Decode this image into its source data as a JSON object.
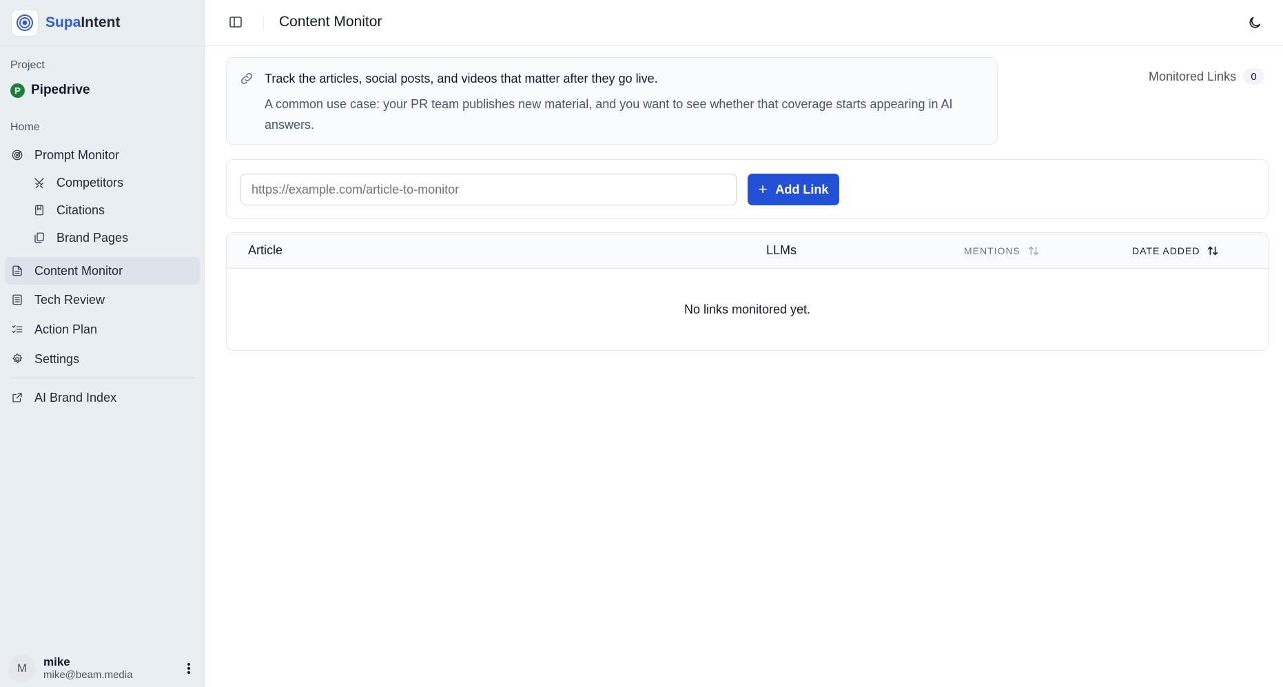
{
  "brand": {
    "name_part1": "Supa",
    "name_part2": "Intent"
  },
  "sidebar": {
    "project_label": "Project",
    "project": {
      "initial": "P",
      "name": "Pipedrive"
    },
    "home_label": "Home",
    "items": [
      {
        "label": "Prompt Monitor",
        "icon": "radar-icon"
      },
      {
        "label": "Competitors",
        "icon": "swords-icon"
      },
      {
        "label": "Citations",
        "icon": "bookmark-icon"
      },
      {
        "label": "Brand Pages",
        "icon": "pages-icon"
      },
      {
        "label": "Content Monitor",
        "icon": "document-icon",
        "active": true
      },
      {
        "label": "Tech Review",
        "icon": "list-document-icon"
      },
      {
        "label": "Action Plan",
        "icon": "checklist-icon"
      },
      {
        "label": "Settings",
        "icon": "gear-icon"
      },
      {
        "label": "AI Brand Index",
        "icon": "external-link-icon"
      }
    ],
    "user": {
      "avatar_initial": "M",
      "name": "mike",
      "email": "mike@beam.media"
    }
  },
  "header": {
    "title": "Content Monitor"
  },
  "info": {
    "title": "Track the articles, social posts, and videos that matter after they go live.",
    "body": "A common use case: your PR team publishes new material, and you want to see whether that coverage starts appearing in AI answers."
  },
  "monitored": {
    "label": "Monitored Links",
    "count": "0"
  },
  "add_link": {
    "placeholder": "https://example.com/article-to-monitor",
    "value": "",
    "button_label": "Add Link"
  },
  "table": {
    "columns": [
      "Article",
      "LLMs",
      "MENTIONS",
      "DATE ADDED"
    ],
    "empty_message": "No links monitored yet."
  },
  "colors": {
    "accent": "#2450d6",
    "sidebar_bg": "#e9eef3",
    "project_badge": "#1b7f3b"
  }
}
